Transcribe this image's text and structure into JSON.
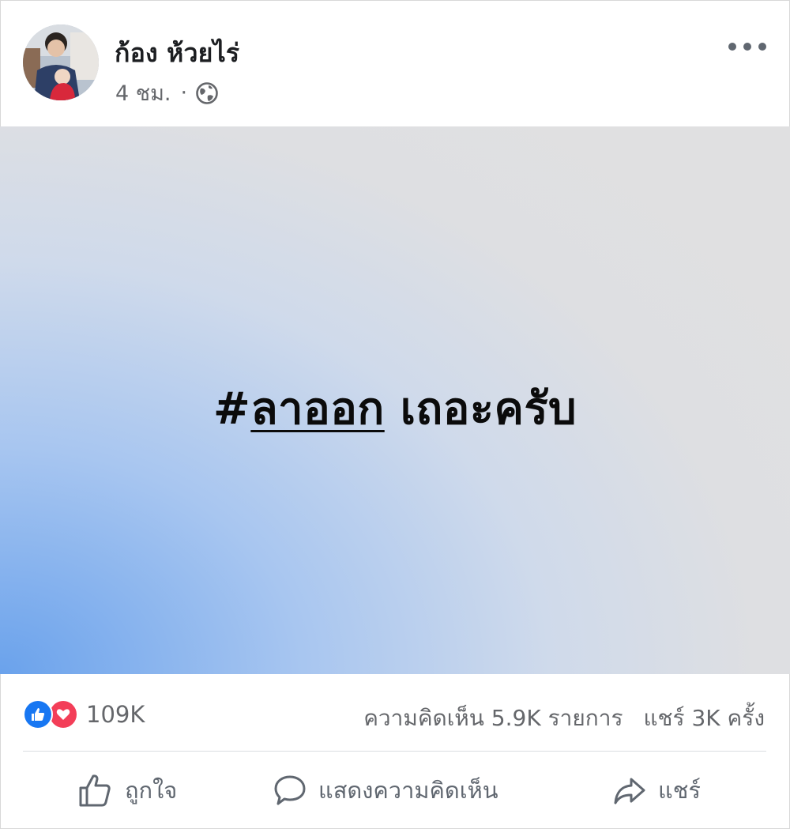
{
  "post": {
    "author": "ก้อง ห้วยไร่",
    "time": "4 ชม.",
    "separator": "·",
    "more_icon": "more-horizontal-icon",
    "privacy_icon": "globe-icon",
    "text_hashtag": "#",
    "text_tag": "ลาออก",
    "text_rest": " เถอะครับ"
  },
  "stats": {
    "reaction_icons": [
      "like-reaction-icon",
      "love-reaction-icon"
    ],
    "reaction_count": "109K",
    "comments": "ความคิดเห็น 5.9K รายการ",
    "shares": "แชร์ 3K ครั้ง"
  },
  "actions": {
    "like_label": "ถูกใจ",
    "comment_label": "แสดงความคิดเห็น",
    "share_label": "แชร์"
  },
  "colors": {
    "like_blue": "#1877f2",
    "love_red": "#f33e58",
    "secondary_text": "#65676b"
  }
}
